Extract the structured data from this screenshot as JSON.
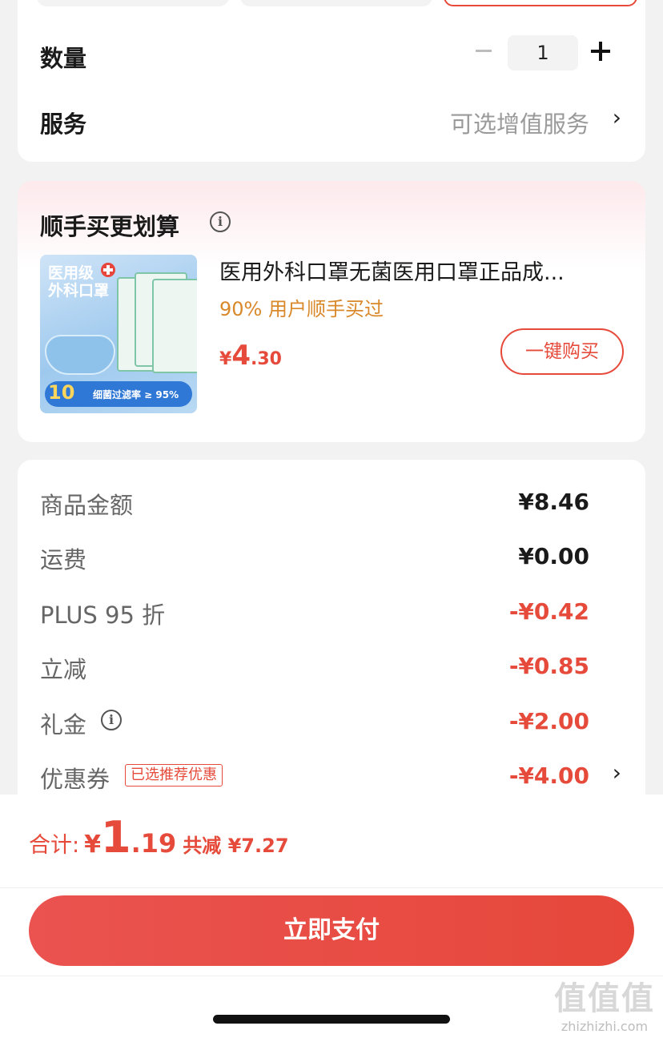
{
  "quantity": {
    "label": "数量",
    "value": "1"
  },
  "service": {
    "label": "服务",
    "value": "可选增值服务",
    "chevron": "›"
  },
  "bundle": {
    "title": "顺手买更划算",
    "info_icon": "i",
    "product": {
      "name": "医用外科口罩无菌医用口罩正品成...",
      "note": "90% 用户顺手买过",
      "price_currency": "¥",
      "price_int": "4",
      "price_dec": ".30",
      "buy_label": "一键购买",
      "image_text": {
        "line1": "医用级",
        "line2": "外科口罩",
        "count": "10",
        "filter": "细菌过滤率 ≥ 95%"
      }
    }
  },
  "price_breakdown": {
    "rows": [
      {
        "label": "商品金额",
        "value": "¥8.46"
      },
      {
        "label": "运费",
        "value": "¥0.00"
      },
      {
        "label": "PLUS 95 折",
        "value": "-¥0.42"
      },
      {
        "label": "立减",
        "value": "-¥0.85"
      },
      {
        "label": "礼金",
        "value": "-¥2.00"
      },
      {
        "label": "优惠券",
        "value": "-¥4.00"
      }
    ],
    "coupon_tag": "已选推荐优惠",
    "chevron": "›"
  },
  "footer": {
    "total_label": "合计:",
    "total_currency": "¥",
    "total_int": "1",
    "total_dec": ".19",
    "saved": "共减 ¥7.27",
    "pay_label": "立即支付"
  },
  "watermark": {
    "big": "值值值",
    "small": "zhizhizhi.com"
  },
  "colors": {
    "accent": "#e64a3b",
    "note": "#d9882a",
    "muted": "#9a9a9a"
  }
}
